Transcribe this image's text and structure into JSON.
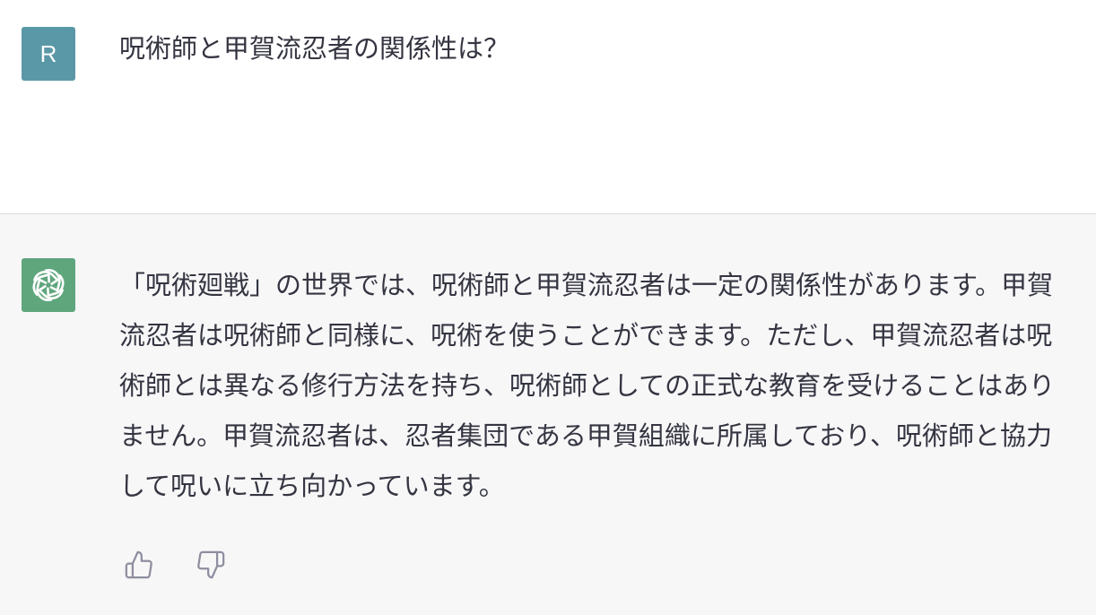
{
  "user_message": {
    "avatar_letter": "R",
    "avatar_color": "#5a98a7",
    "text": "呪術師と甲賀流忍者の関係性は？"
  },
  "assistant_message": {
    "avatar_icon": "openai-logo-icon",
    "avatar_color": "#5fa67d",
    "text": "「呪術廻戦」の世界では、呪術師と甲賀流忍者は一定の関係性があります。甲賀流忍者は呪術師と同様に、呪術を使うことができます。ただし、甲賀流忍者は呪術師とは異なる修行方法を持ち、呪術師としての正式な教育を受けることはありません。甲賀流忍者は、忍者集団である甲賀組織に所属しており、呪術師と協力して呪いに立ち向かっています。"
  },
  "feedback": {
    "thumbs_up_icon": "thumbs-up-icon",
    "thumbs_down_icon": "thumbs-down-icon"
  }
}
